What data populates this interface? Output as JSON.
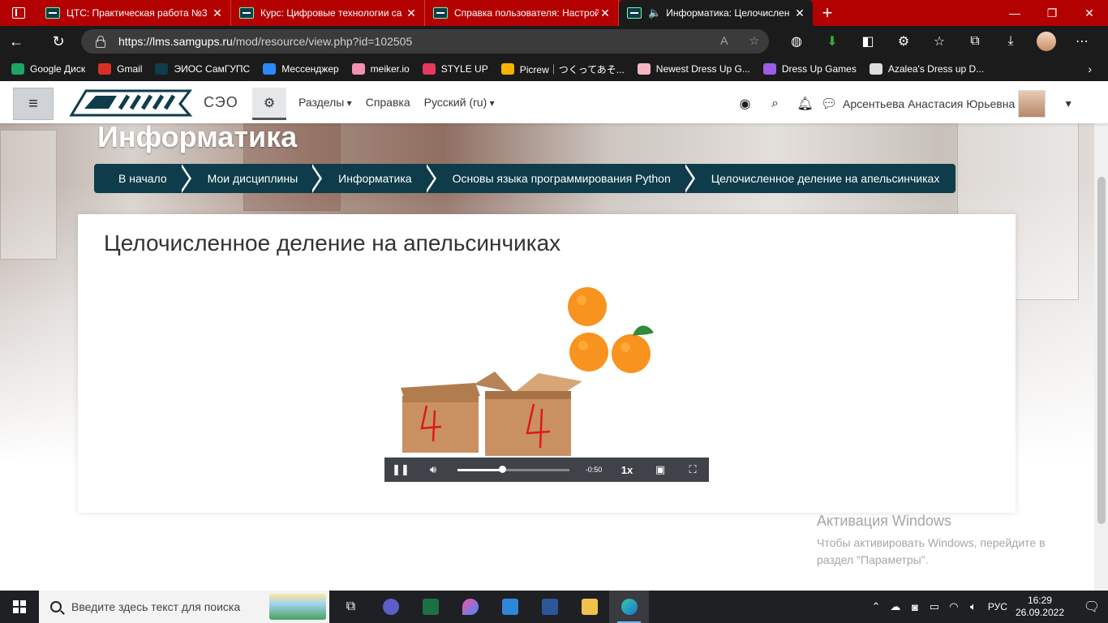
{
  "browser": {
    "tabs": [
      {
        "title": "ЦТС: Практическая работа №3",
        "active": false
      },
      {
        "title": "Курс: Цифровые технологии са",
        "active": false
      },
      {
        "title": "Справка пользователя: Настрой",
        "active": false
      },
      {
        "title": "Информатика: Целочислен",
        "active": true
      }
    ],
    "close_glyph": "✕",
    "new_tab_glyph": "+",
    "url_host": "https://lms.samgups.ru",
    "url_path": "/mod/resource/view.php?id=102505",
    "bookmarks": [
      {
        "label": "Google Диск",
        "color": "#1fa463"
      },
      {
        "label": "Gmail",
        "color": "#d93025"
      },
      {
        "label": "ЭИОС СамГУПС",
        "color": "#0e3c4a"
      },
      {
        "label": "Мессенджер",
        "color": "#2d88ff"
      },
      {
        "label": "meiker.io",
        "color": "#f48fb1"
      },
      {
        "label": "STYLE UP",
        "color": "#e5395f"
      },
      {
        "label": "Picrew｜つくってあそ...",
        "color": "#f6b400"
      },
      {
        "label": "Newest Dress Up G...",
        "color": "#f7b6c2"
      },
      {
        "label": "Dress Up Games",
        "color": "#9b5de5"
      },
      {
        "label": "Azalea's Dress up D...",
        "color": "#dddddd"
      }
    ]
  },
  "moodle": {
    "site_name": "СЭО",
    "menu": {
      "sections": "Разделы",
      "help": "Справка",
      "language": "Русский (ru)"
    },
    "user_name": "Арсентьева Анастасия Юрьевна",
    "course_title": "Информатика",
    "breadcrumb": [
      "В начало",
      "Мои дисциплины",
      "Информатика",
      "Основы языка программирования Python",
      "Целочисленное деление на апельсинчиках"
    ],
    "page_title": "Целочисленное деление на апельсинчиках",
    "video": {
      "remaining": "-0:50",
      "rate": "1x",
      "progress_fraction": 0.4,
      "box_digit_left": "4",
      "box_digit_right": "4",
      "oranges": 3
    },
    "accent_color": "#0e3c4a"
  },
  "watermark": {
    "title": "Активация Windows",
    "line1": "Чтобы активировать Windows, перейдите в",
    "line2": "раздел \"Параметры\"."
  },
  "taskbar": {
    "search_placeholder": "Введите здесь текст для поиска",
    "time": "16:29",
    "date": "26.09.2022",
    "lang": "РУС"
  }
}
